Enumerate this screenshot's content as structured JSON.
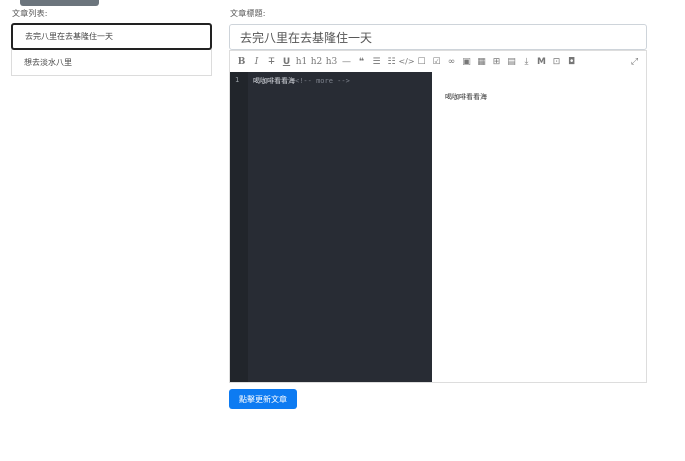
{
  "sidebar": {
    "label": "文章列表:",
    "items": [
      {
        "label": "去完八里在去基隆住一天"
      },
      {
        "label": "想去淡水八里"
      }
    ]
  },
  "main": {
    "title_label": "文章標題:",
    "title_value": "去完八里在去基隆住一天",
    "editor": {
      "toolbar": [
        "bold-icon",
        "italic-icon",
        "strikethrough-icon",
        "underline-icon",
        "h1",
        "h2",
        "h3",
        "hr-icon",
        "quote-icon",
        "unordered-list-icon",
        "ordered-list-icon",
        "code-icon",
        "checkbox-icon",
        "checkbox-checked-icon",
        "link-icon",
        "image-icon",
        "table-icon",
        "toc-icon",
        "video-icon",
        "download-icon",
        "markdown-icon",
        "image-upload-icon",
        "record-icon",
        "fullscreen-icon"
      ],
      "line_number": "1",
      "code_text": "喝咖啡看看海",
      "code_comment": "<!-- more -->",
      "preview_text": "喝咖啡看看海"
    },
    "submit_label": "點擊更新文章"
  }
}
